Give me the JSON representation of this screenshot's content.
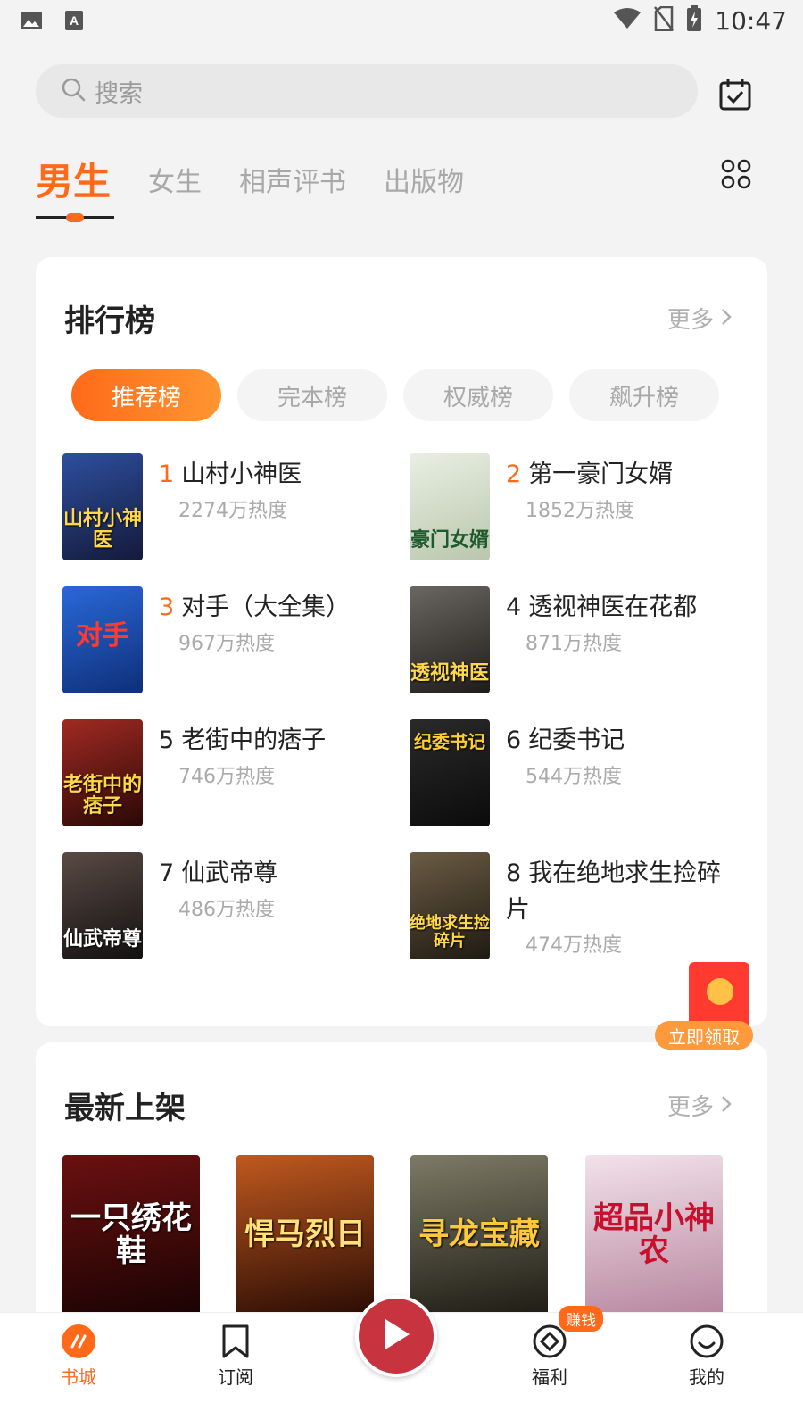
{
  "status_bar": {
    "time": "10:47"
  },
  "search": {
    "placeholder": "搜索"
  },
  "top_tabs": [
    {
      "label": "男生",
      "active": true
    },
    {
      "label": "女生",
      "active": false
    },
    {
      "label": "相声评书",
      "active": false
    },
    {
      "label": "出版物",
      "active": false
    }
  ],
  "ranking": {
    "title": "排行榜",
    "more": "更多",
    "tabs": [
      "推荐榜",
      "完本榜",
      "权威榜",
      "飙升榜"
    ],
    "books": [
      {
        "rank": "1",
        "title": "山村小神医",
        "heat": "2274万热度",
        "cover_text": "山村小神医",
        "cover_color": "#1f3a7a"
      },
      {
        "rank": "2",
        "title": "第一豪门女婿",
        "heat": "1852万热度",
        "cover_text": "豪门女婿",
        "cover_color": "#dfe6d8"
      },
      {
        "rank": "3",
        "title": "对手（大全集）",
        "heat": "967万热度",
        "cover_text": "对手",
        "cover_color": "#1a4fbf"
      },
      {
        "rank": "4",
        "title": "透视神医在花都",
        "heat": "871万热度",
        "cover_text": "透视神医",
        "cover_color": "#3c3a38"
      },
      {
        "rank": "5",
        "title": "老街中的痞子",
        "heat": "746万热度",
        "cover_text": "老街中的痞子",
        "cover_color": "#7a1a16"
      },
      {
        "rank": "6",
        "title": "纪委书记",
        "heat": "544万热度",
        "cover_text": "纪委书记",
        "cover_color": "#1b1b1b"
      },
      {
        "rank": "7",
        "title": "仙武帝尊",
        "heat": "486万热度",
        "cover_text": "仙武帝尊",
        "cover_color": "#2a2422"
      },
      {
        "rank": "8",
        "title": "我在绝地求生捡碎片",
        "heat": "474万热度",
        "cover_text": "绝地求生捡碎片",
        "cover_color": "#3a3226"
      }
    ]
  },
  "red_packet": {
    "label": "立即领取"
  },
  "new_shelf": {
    "title": "最新上架",
    "more": "更多",
    "books": [
      {
        "cover_text": "一只绣花鞋",
        "cover_color": "#4a0d0d"
      },
      {
        "cover_text": "悍马烈日",
        "cover_color": "#6b2a10"
      },
      {
        "cover_text": "寻龙宝藏",
        "cover_color": "#4b4a3a"
      },
      {
        "cover_text": "超品小神农",
        "cover_color": "#c9a8b8"
      }
    ]
  },
  "bottom_nav": [
    {
      "label": "书城",
      "icon": "bookstore-icon",
      "active": true
    },
    {
      "label": "订阅",
      "icon": "bookmark-icon",
      "active": false
    },
    {
      "label": "福利",
      "icon": "welfare-icon",
      "active": false,
      "badge": "赚钱"
    },
    {
      "label": "我的",
      "icon": "profile-icon",
      "active": false
    }
  ],
  "colors": {
    "accent": "#ff6a1a",
    "red_packet": "#ff3b30"
  }
}
